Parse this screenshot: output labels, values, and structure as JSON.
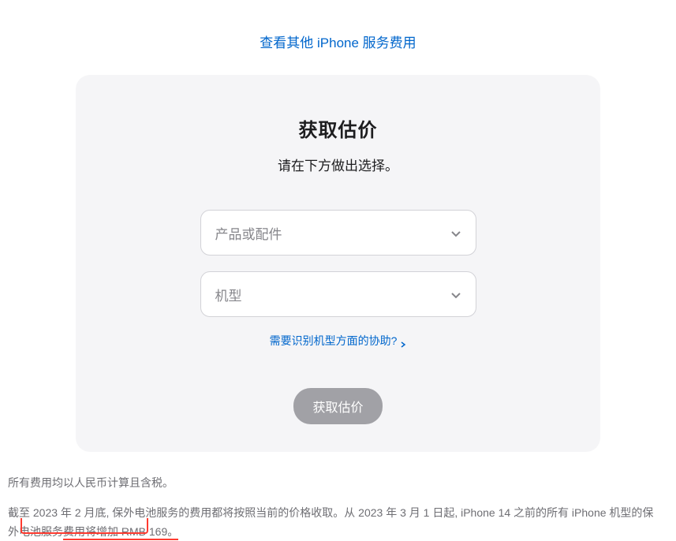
{
  "topLink": {
    "label": "查看其他 iPhone 服务费用"
  },
  "card": {
    "title": "获取估价",
    "subtitle": "请在下方做出选择。",
    "select1": {
      "placeholder": "产品或配件"
    },
    "select2": {
      "placeholder": "机型"
    },
    "helpLink": {
      "label": "需要识别机型方面的协助?"
    },
    "submitButton": {
      "label": "获取估价"
    }
  },
  "footer": {
    "line1": "所有费用均以人民币计算且含税。",
    "notice": {
      "part1": "截至 2023 年 2 月底, 保外电池服务的费用都将按照当前的价格收取。从 2023 年 3 月 1 日起, iPhone 14 之前的所有 iPhone 机型的保外电池服务",
      "highlight": "费用将增加 RMB 169。"
    }
  }
}
